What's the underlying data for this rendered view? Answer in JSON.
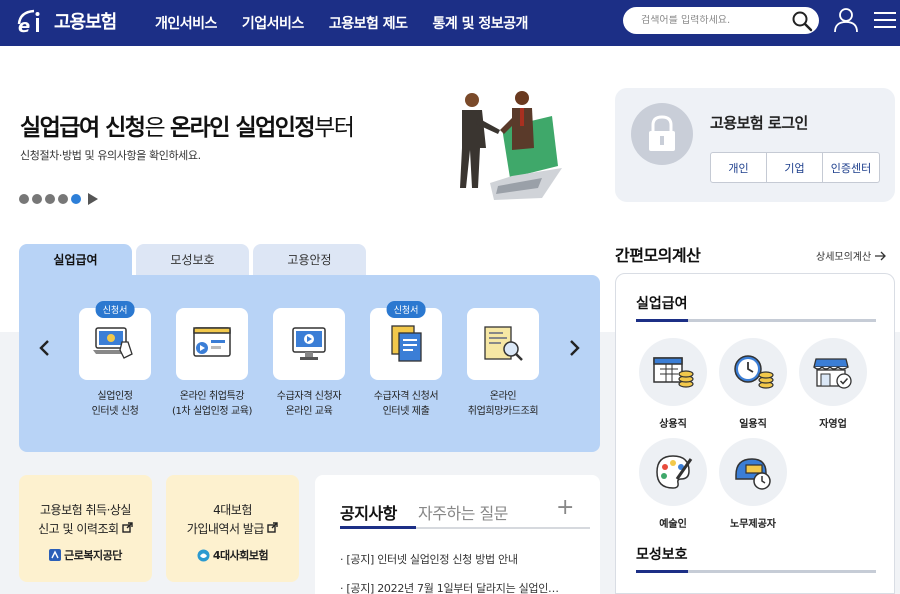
{
  "header": {
    "logo_text": "고용보험",
    "nav": [
      "개인서비스",
      "기업서비스",
      "고용보험 제도",
      "통계 및 정보공개"
    ],
    "search_placeholder": "검색어를 입력하세요."
  },
  "hero": {
    "title_bold_1": "실업급여 신청",
    "title_light_1": "은 ",
    "title_bold_2": "온라인 실업인정",
    "title_light_2": "부터",
    "subtitle": "신청절차·방법 및 유의사항을 확인하세요.",
    "slide_count": 5,
    "active_slide": 5
  },
  "login": {
    "title": "고용보험 로그인",
    "buttons": [
      "개인",
      "기업",
      "인증센터"
    ]
  },
  "service_tabs": {
    "tabs": [
      "실업급여",
      "모성보호",
      "고용안정"
    ],
    "active_tab": 0,
    "items": [
      {
        "badge": "신청서",
        "line1": "실업인정",
        "line2": "인터넷 신청",
        "icon": "laptop-hand-icon"
      },
      {
        "badge": "",
        "line1": "온라인 취업특강",
        "line2": "(1차 실업인정 교육)",
        "icon": "video-lecture-icon"
      },
      {
        "badge": "",
        "line1": "수급자격 신청자",
        "line2": "온라인 교육",
        "icon": "monitor-play-icon"
      },
      {
        "badge": "신청서",
        "line1": "수급자격 신청서",
        "line2": "인터넷 제출",
        "icon": "documents-icon"
      },
      {
        "badge": "",
        "line1": "온라인",
        "line2": "취업희망카드조회",
        "icon": "card-search-icon"
      }
    ]
  },
  "quick_cards": [
    {
      "line1": "고용보험 취득·상실",
      "line2": "신고 및 이력조회",
      "org": "근로복지공단"
    },
    {
      "line1": "4대보험",
      "line2": "가입내역서 발급",
      "org": "4대사회보험"
    }
  ],
  "notice": {
    "tabs": [
      "공지사항",
      "자주하는 질문"
    ],
    "plus": "+",
    "items": [
      "[공지] 인터넷 실업인정 신청 방법 안내",
      "[공지] 2022년 7월 1일부터 달라지는 실업인…"
    ]
  },
  "calc": {
    "title": "간편모의계산",
    "more": "상세모의계산",
    "section1": "실업급여",
    "items": [
      {
        "label": "상용직",
        "icon": "calendar-coins-icon"
      },
      {
        "label": "일용직",
        "icon": "clock-coins-icon"
      },
      {
        "label": "자영업",
        "icon": "store-icon"
      },
      {
        "label": "예술인",
        "icon": "palette-icon"
      },
      {
        "label": "노무제공자",
        "icon": "helmet-clock-icon"
      }
    ],
    "section2": "모성보호"
  },
  "colors": {
    "header_bg": "#1c2f86",
    "panel_bg": "#b8d3f6",
    "badge": "#2b78d0",
    "card_yellow": "#fdf1cf"
  }
}
